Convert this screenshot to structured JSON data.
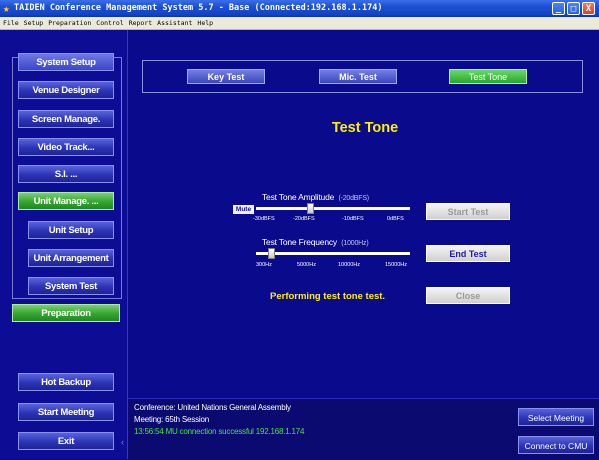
{
  "window": {
    "title": "TAIDEN Conference Management System 5.7 - Base (Connected:192.168.1.174)",
    "minimize": "_",
    "maximize": "□",
    "close": "X"
  },
  "menu": [
    "File",
    "Setup",
    "Preparation",
    "Control",
    "Report",
    "Assistant",
    "Help"
  ],
  "sidebar": {
    "system_setup": "System Setup",
    "venue_designer": "Venue Designer",
    "screen_manage": "Screen Manage.",
    "video_track": "Video Track...",
    "si": "S.I. ...",
    "unit_manage": "Unit Manage. ...",
    "unit_setup": "Unit Setup",
    "unit_arrangement": "Unit Arrangement",
    "system_test": "System Test",
    "preparation": "Preparation",
    "hot_backup": "Hot Backup",
    "start_meeting": "Start Meeting",
    "exit": "Exit"
  },
  "tabs": {
    "key_test": "Key Test",
    "mic_test": "Mic. Test",
    "test_tone": "Test Tone"
  },
  "page_title": "Test Tone",
  "amplitude": {
    "label": "Test Tone Amplitude",
    "current": "(-20dBFS)",
    "mute": "Mute",
    "ticks": [
      "-30dBFS",
      "-20dBFS",
      "-10dBFS",
      "0dBFS"
    ],
    "value_dbfs": -20,
    "range_dbfs": [
      -30,
      0
    ]
  },
  "frequency": {
    "label": "Test Tone Frequency",
    "current": "(1000Hz)",
    "ticks": [
      "300Hz",
      "5000Hz",
      "10000Hz",
      "15000Hz"
    ],
    "value_hz": 1000,
    "range_hz": [
      300,
      15000
    ]
  },
  "buttons": {
    "start_test": "Start Test",
    "end_test": "End Test",
    "close": "Close"
  },
  "status_message": "Performing test tone test.",
  "footer": {
    "conference": "Conference: United Nations General Assembly",
    "meeting": "Meeting: 65th Session",
    "connection": "13:56:54 MU connection successful 192.168.1.174",
    "select_meeting": "Select Meeting",
    "connect_to_cmu": "Connect to CMU"
  },
  "colors": {
    "background": "#0a0a8c",
    "accent_yellow": "#ffee00",
    "selected_green": "#32a02e",
    "status_green": "#44e844"
  }
}
